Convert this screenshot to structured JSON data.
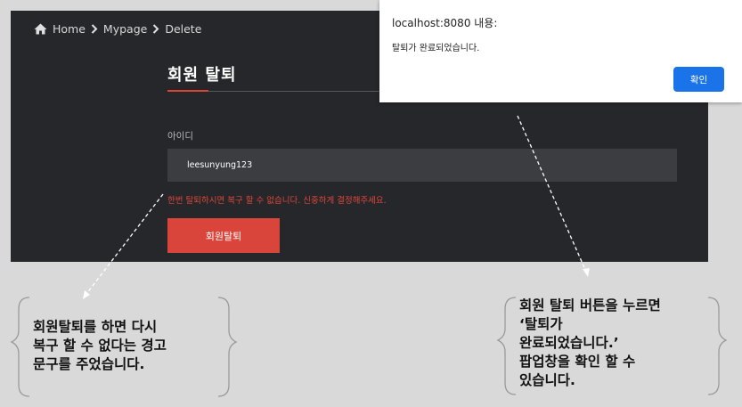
{
  "breadcrumb": {
    "home": "Home",
    "mypage": "Mypage",
    "delete": "Delete"
  },
  "page": {
    "title": "회원 탈퇴",
    "field_label": "아이디",
    "username": "leesunyung123",
    "warning": "한번 탈퇴하시면 복구 할 수 없습니다. 신중하게 결정해주세요.",
    "delete_button": "회원탈퇴"
  },
  "dialog": {
    "title": "localhost:8080 내용:",
    "message": "탈퇴가 완료되었습니다.",
    "ok_button": "확인"
  },
  "annotations": {
    "left": [
      "회원탈퇴를 하면 다시",
      "복구 할 수 없다는 경고",
      "문구를 주었습니다."
    ],
    "right": [
      "회원 탈퇴 버튼을 누르면",
      "‘탈퇴가",
      "완료되었습니다.’",
      "팝업창을 확인 할 수",
      "있습니다."
    ]
  },
  "colors": {
    "background": "#d9d9d9",
    "screen": "#25272a",
    "accent_red": "#d9453a",
    "dialog_button": "#1a73e8"
  },
  "icons": [
    "home-icon",
    "chevron-right-icon",
    "brace-icon"
  ]
}
